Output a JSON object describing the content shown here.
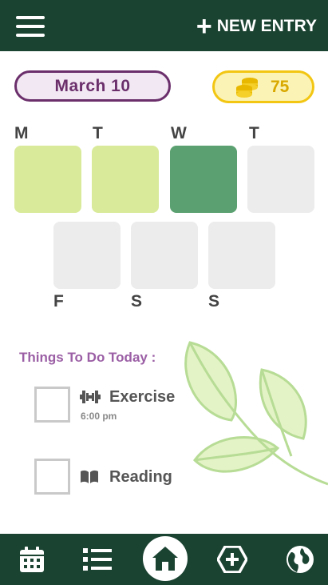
{
  "header": {
    "new_entry_plus": "+",
    "new_entry_label": "NEW ENTRY"
  },
  "date": {
    "label": "March  10"
  },
  "coins": {
    "value": "75"
  },
  "week": {
    "top_days": [
      {
        "letter": "M",
        "status": "completed"
      },
      {
        "letter": "T",
        "status": "completed"
      },
      {
        "letter": "W",
        "status": "current"
      },
      {
        "letter": "T",
        "status": "empty"
      }
    ],
    "bottom_days": [
      {
        "letter": "F",
        "status": "empty"
      },
      {
        "letter": "S",
        "status": "empty"
      },
      {
        "letter": "S",
        "status": "empty"
      }
    ]
  },
  "todo": {
    "heading": "Things To Do Today :",
    "items": [
      {
        "label": "Exercise",
        "time": "6:00 pm",
        "icon": "dumbbell-icon"
      },
      {
        "label": "Reading",
        "time": "",
        "icon": "book-icon"
      }
    ]
  },
  "nav": {
    "items": [
      "calendar-icon",
      "list-icon",
      "home-icon",
      "add-icon",
      "globe-icon"
    ],
    "active": "home-icon"
  },
  "colors": {
    "header_bg": "#1b4332",
    "date_border": "#6b2f6b",
    "coin_border": "#f2c612",
    "tile_completed": "#d9ea9a",
    "tile_current": "#5aa070",
    "tile_empty": "#ececec",
    "todo_heading": "#9b5fa5"
  }
}
